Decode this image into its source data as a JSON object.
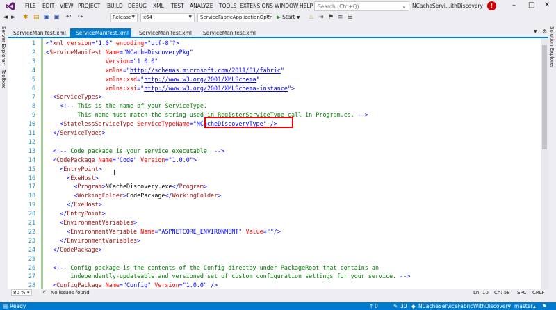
{
  "menu": [
    "FILE",
    "EDIT",
    "VIEW",
    "PROJECT",
    "BUILD",
    "DEBUG",
    "XML",
    "TEST",
    "ANALYZE",
    "TOOLS",
    "EXTENSIONS",
    "WINDOW",
    "HELP"
  ],
  "quick_launch_placeholder": "Search (Ctrl+Q)",
  "window_title": "NCacheServi...ithDiscovery",
  "toolbar": {
    "configuration": "Release",
    "platform": "x64",
    "startup_project": "ServiceFabricApplicationOpenCont",
    "start_label": "Start"
  },
  "side_panels": {
    "left": [
      "Server Explorer",
      "Toolbox"
    ],
    "right": [
      "Solution Explorer"
    ]
  },
  "tabs": [
    {
      "label": "ServiceManifest.xml",
      "active": false
    },
    {
      "label": "ServiceManifest.xml",
      "active": true
    },
    {
      "label": "ServiceManifest.xml",
      "active": false
    },
    {
      "label": "ServiceManifest.xml",
      "active": false
    }
  ],
  "editor": {
    "line_numbers": [
      "1",
      "2",
      "3",
      "4",
      "5",
      "6",
      "7",
      "8",
      "9",
      "10",
      "11",
      "12",
      "13",
      "14",
      "15",
      "16",
      "17",
      "18",
      "19",
      "20",
      "21",
      "22",
      "23",
      "24",
      "25",
      "26",
      "27",
      "28"
    ],
    "lines": [
      {
        "segments": [
          [
            "d",
            "<?"
          ],
          [
            "t",
            "xml"
          ],
          [
            "a",
            " version"
          ],
          [
            "d",
            "=\""
          ],
          [
            "v",
            "1.0"
          ],
          [
            "d",
            "\""
          ],
          [
            "a",
            " encoding"
          ],
          [
            "d",
            "=\""
          ],
          [
            "v",
            "utf-8"
          ],
          [
            "d",
            "\"?>"
          ]
        ]
      },
      {
        "segments": [
          [
            "d",
            "<"
          ],
          [
            "t",
            "ServiceManifest"
          ],
          [
            "a",
            " Name"
          ],
          [
            "d",
            "=\""
          ],
          [
            "v",
            "NCacheDiscoveryPkg"
          ],
          [
            "d",
            "\""
          ]
        ]
      },
      {
        "segments": [
          [
            "a",
            "                 Version"
          ],
          [
            "d",
            "=\""
          ],
          [
            "v",
            "1.0.0"
          ],
          [
            "d",
            "\""
          ]
        ]
      },
      {
        "segments": [
          [
            "a",
            "                 xmlns"
          ],
          [
            "d",
            "=\""
          ],
          [
            "u",
            "http://schemas.microsoft.com/2011/01/fabric"
          ],
          [
            "d",
            "\""
          ]
        ]
      },
      {
        "segments": [
          [
            "a",
            "                 xmlns:xsd"
          ],
          [
            "d",
            "=\""
          ],
          [
            "u",
            "http://www.w3.org/2001/XMLSchema"
          ],
          [
            "d",
            "\""
          ]
        ]
      },
      {
        "segments": [
          [
            "a",
            "                 xmlns:xsi"
          ],
          [
            "d",
            "=\""
          ],
          [
            "u",
            "http://www.w3.org/2001/XMLSchema-instance"
          ],
          [
            "d",
            "\">"
          ]
        ]
      },
      {
        "segments": [
          [
            "d",
            "  <"
          ],
          [
            "t",
            "ServiceTypes"
          ],
          [
            "d",
            ">"
          ]
        ]
      },
      {
        "segments": [
          [
            "d",
            "    <!--"
          ],
          [
            "c",
            " This is the name of your ServiceType."
          ]
        ]
      },
      {
        "segments": [
          [
            "c",
            "         This name must match the string used in RegisterServiceType call in Program.cs. "
          ],
          [
            "d",
            "-->"
          ]
        ]
      },
      {
        "segments": [
          [
            "d",
            "    <"
          ],
          [
            "t",
            "StatelessServiceType"
          ],
          [
            "a",
            " ServiceTypeName"
          ],
          [
            "d",
            "=\""
          ],
          [
            "v",
            "NCacheDiscoveryType"
          ],
          [
            "d",
            "\""
          ],
          [
            "d",
            " />"
          ]
        ]
      },
      {
        "segments": [
          [
            "d",
            "  </"
          ],
          [
            "t",
            "ServiceTypes"
          ],
          [
            "d",
            ">"
          ]
        ]
      },
      {
        "segments": []
      },
      {
        "segments": [
          [
            "d",
            "  <!--"
          ],
          [
            "c",
            " Code package is your service executable. "
          ],
          [
            "d",
            "-->"
          ]
        ]
      },
      {
        "segments": [
          [
            "d",
            "  <"
          ],
          [
            "t",
            "CodePackage"
          ],
          [
            "a",
            " Name"
          ],
          [
            "d",
            "=\""
          ],
          [
            "v",
            "Code"
          ],
          [
            "d",
            "\""
          ],
          [
            "a",
            " Version"
          ],
          [
            "d",
            "=\""
          ],
          [
            "v",
            "1.0.0"
          ],
          [
            "d",
            "\">"
          ]
        ]
      },
      {
        "segments": [
          [
            "d",
            "    <"
          ],
          [
            "t",
            "EntryPoint"
          ],
          [
            "d",
            ">"
          ]
        ]
      },
      {
        "segments": [
          [
            "d",
            "      <"
          ],
          [
            "t",
            "ExeHost"
          ],
          [
            "d",
            ">"
          ]
        ]
      },
      {
        "segments": [
          [
            "d",
            "        <"
          ],
          [
            "t",
            "Program"
          ],
          [
            "d",
            ">"
          ],
          [
            "txt",
            "NCacheDiscovery.exe"
          ],
          [
            "d",
            "</"
          ],
          [
            "t",
            "Program"
          ],
          [
            "d",
            ">"
          ]
        ]
      },
      {
        "segments": [
          [
            "d",
            "        <"
          ],
          [
            "t",
            "WorkingFolder"
          ],
          [
            "d",
            ">"
          ],
          [
            "txt",
            "CodePackage"
          ],
          [
            "d",
            "</"
          ],
          [
            "t",
            "WorkingFolder"
          ],
          [
            "d",
            ">"
          ]
        ]
      },
      {
        "segments": [
          [
            "d",
            "      </"
          ],
          [
            "t",
            "ExeHost"
          ],
          [
            "d",
            ">"
          ]
        ]
      },
      {
        "segments": [
          [
            "d",
            "    </"
          ],
          [
            "t",
            "EntryPoint"
          ],
          [
            "d",
            ">"
          ]
        ]
      },
      {
        "segments": [
          [
            "d",
            "    <"
          ],
          [
            "t",
            "EnvironmentVariables"
          ],
          [
            "d",
            ">"
          ]
        ]
      },
      {
        "segments": [
          [
            "d",
            "      <"
          ],
          [
            "t",
            "EnvironmentVariable"
          ],
          [
            "a",
            " Name"
          ],
          [
            "d",
            "=\""
          ],
          [
            "v",
            "ASPNETCORE_ENVIRONMENT"
          ],
          [
            "d",
            "\""
          ],
          [
            "a",
            " Value"
          ],
          [
            "d",
            "=\"\"/>"
          ]
        ]
      },
      {
        "segments": [
          [
            "d",
            "    </"
          ],
          [
            "t",
            "EnvironmentVariables"
          ],
          [
            "d",
            ">"
          ]
        ]
      },
      {
        "segments": [
          [
            "d",
            "  </"
          ],
          [
            "t",
            "CodePackage"
          ],
          [
            "d",
            ">"
          ]
        ]
      },
      {
        "segments": []
      },
      {
        "segments": [
          [
            "d",
            "  <!--"
          ],
          [
            "c",
            " Config package is the contents of the Config directoy under PackageRoot that contains an"
          ]
        ]
      },
      {
        "segments": [
          [
            "c",
            "       independently-updateable and versioned set of custom configuration settings for your service. "
          ],
          [
            "d",
            "-->"
          ]
        ]
      },
      {
        "segments": [
          [
            "d",
            "  <"
          ],
          [
            "t",
            "ConfigPackage"
          ],
          [
            "a",
            " Name"
          ],
          [
            "d",
            "=\""
          ],
          [
            "v",
            "Config"
          ],
          [
            "d",
            "\""
          ],
          [
            "a",
            " Version"
          ],
          [
            "d",
            "=\""
          ],
          [
            "v",
            "1.0.0"
          ],
          [
            "d",
            "\" />"
          ]
        ]
      }
    ]
  },
  "editor_status": {
    "zoom": "80 %",
    "issues": "No issues found",
    "line": "Ln: 10",
    "col": "Ch: 58",
    "mode": "SPC",
    "eol": "CRLF"
  },
  "statusbar": {
    "ready": "Ready",
    "up_count": "0",
    "pencil_count": "30",
    "repo": "NCacheServiceFabricWithDiscovery",
    "branch": "master"
  },
  "colors": {
    "accent": "#007acc",
    "tag": "#a31515",
    "attribute": "#ff0000",
    "value": "#0000ff",
    "comment": "#008000",
    "highlight_box": "#e00000"
  }
}
